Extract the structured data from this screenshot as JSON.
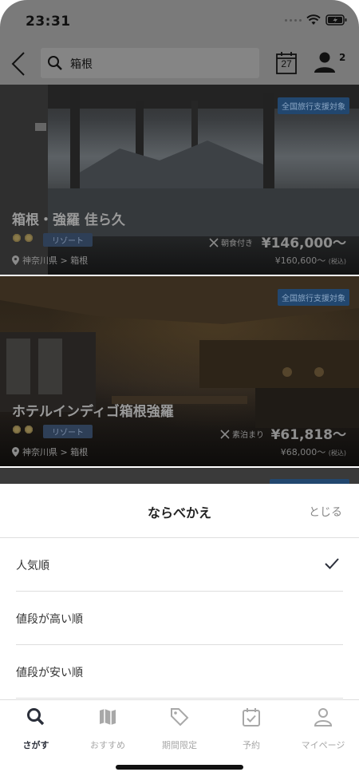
{
  "status_bar": {
    "time": "23:31"
  },
  "header": {
    "search_value": "箱根",
    "calendar_day": "27",
    "guest_count": "2"
  },
  "hotels": [
    {
      "campaign_badge": "全国旅行支援対象",
      "name": "箱根・強羅 佳ら久",
      "stars": 2,
      "category": "リゾート",
      "location": "神奈川県 > 箱根",
      "meal": "朝食付き",
      "price": "¥146,000〜",
      "original_price": "¥160,600〜",
      "tax_note": "(税込)"
    },
    {
      "campaign_badge": "全国旅行支援対象",
      "name": "ホテルインディゴ箱根強羅",
      "stars": 2,
      "category": "リゾート",
      "location": "神奈川県 > 箱根",
      "meal": "素泊まり",
      "price": "¥61,818〜",
      "original_price": "¥68,000〜",
      "tax_note": "(税込)"
    }
  ],
  "sort_sheet": {
    "title": "ならべかえ",
    "close_label": "とじる",
    "options": [
      {
        "label": "人気順",
        "selected": true
      },
      {
        "label": "値段が高い順",
        "selected": false
      },
      {
        "label": "値段が安い順",
        "selected": false
      }
    ]
  },
  "tabbar": {
    "items": [
      {
        "label": "さがす",
        "icon": "search-icon",
        "active": true
      },
      {
        "label": "おすすめ",
        "icon": "map-icon",
        "active": false
      },
      {
        "label": "期間限定",
        "icon": "tag-icon",
        "active": false
      },
      {
        "label": "予約",
        "icon": "calendar-check-icon",
        "active": false
      },
      {
        "label": "マイページ",
        "icon": "person-icon",
        "active": false
      }
    ]
  },
  "colors": {
    "overlay": "#7a7a7a",
    "campaign_badge_bg": "#22476f",
    "category_badge_bg": "#2e3f57",
    "active_tab": "#2b2f3a",
    "inactive_tab": "#a8a8a8"
  }
}
